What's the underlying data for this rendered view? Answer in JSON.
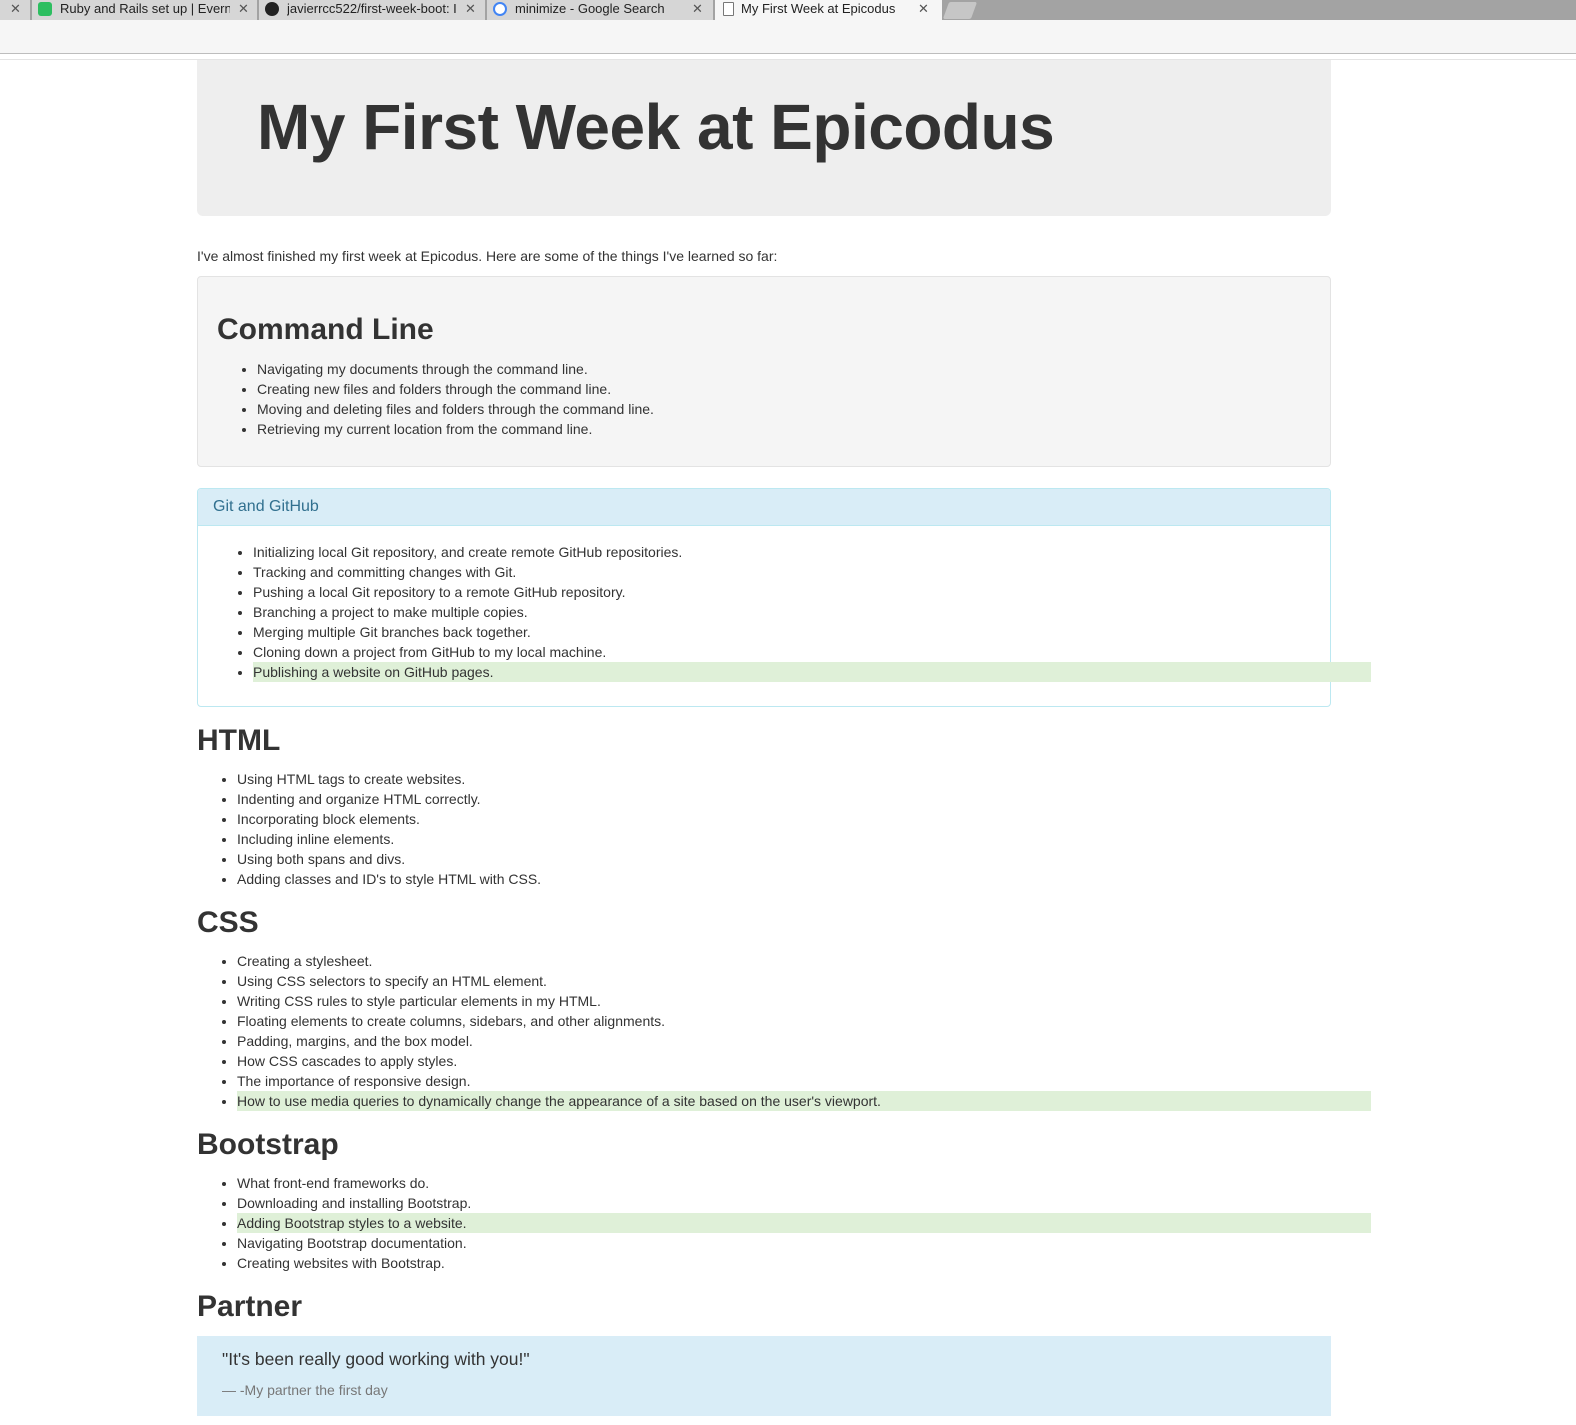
{
  "browser": {
    "tabs": [
      {
        "title": "Ruby and Rails set up | Everno",
        "favicon": "evernote-icon"
      },
      {
        "title": "javierrcc522/first-week-boot: I",
        "favicon": "github-icon"
      },
      {
        "title": "minimize - Google Search",
        "favicon": "google-icon"
      },
      {
        "title": "My First Week at Epicodus",
        "favicon": "page-icon",
        "active": true
      }
    ],
    "close_glyph": "✕"
  },
  "page": {
    "heading": "My First Week at Epicodus",
    "intro": "I've almost finished my first week at Epicodus. Here are some of the things I've learned so far:",
    "command_line": {
      "title": "Command Line",
      "items": [
        "Navigating my documents through the command line.",
        "Creating new files and folders through the command line.",
        "Moving and deleting files and folders through the command line.",
        "Retrieving my current location from the command line."
      ]
    },
    "git": {
      "title": "Git and GitHub",
      "items": [
        "Initializing local Git repository, and create remote GitHub repositories.",
        "Tracking and committing changes with Git.",
        "Pushing a local Git repository to a remote GitHub repository.",
        "Branching a project to make multiple copies.",
        "Merging multiple Git branches back together.",
        "Cloning down a project from GitHub to my local machine.",
        "Publishing a website on GitHub pages."
      ]
    },
    "html": {
      "title": "HTML",
      "items": [
        "Using HTML tags to create websites.",
        "Indenting and organize HTML correctly.",
        "Incorporating block elements.",
        "Including inline elements.",
        "Using both spans and divs.",
        "Adding classes and ID's to style HTML with CSS."
      ]
    },
    "css": {
      "title": "CSS",
      "items": [
        "Creating a stylesheet.",
        "Using CSS selectors to specify an HTML element.",
        "Writing CSS rules to style particular elements in my HTML.",
        "Floating elements to create columns, sidebars, and other alignments.",
        "Padding, margins, and the box model.",
        "How CSS cascades to apply styles.",
        "The importance of responsive design.",
        "How to use media queries to dynamically change the appearance of a site based on the user's viewport."
      ]
    },
    "bootstrap": {
      "title": "Bootstrap",
      "items": [
        "What front-end frameworks do.",
        "Downloading and installing Bootstrap.",
        "Adding Bootstrap styles to a website.",
        "Navigating Bootstrap documentation.",
        "Creating websites with Bootstrap."
      ]
    },
    "partner": {
      "title": "Partner",
      "quote": "\"It's been really good working with you!\"",
      "footer": "— -My partner the first day"
    }
  }
}
